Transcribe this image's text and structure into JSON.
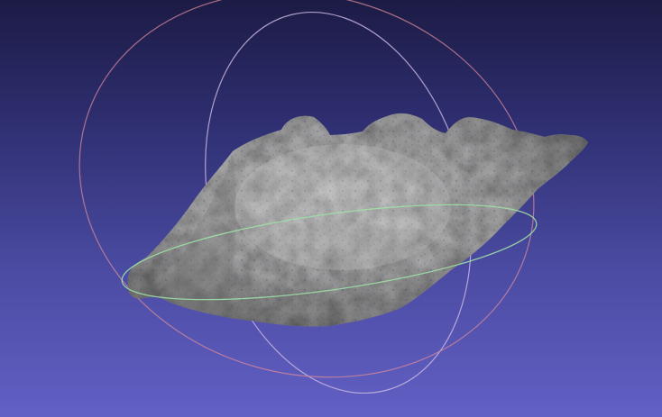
{
  "viewport": {
    "background_top": "#1c1b45",
    "background_bottom": "#6260c4"
  },
  "mesh": {
    "icon": "3d-mesh-rock",
    "color": "#b9b9b9",
    "shadow_color": "#6f6f6f",
    "vertex_color": "#2a2a80"
  },
  "trackball": {
    "x_ring_color": "#d88a9a",
    "y_ring_color": "#c9b6e0",
    "z_ring_color": "#9fe0a6"
  }
}
